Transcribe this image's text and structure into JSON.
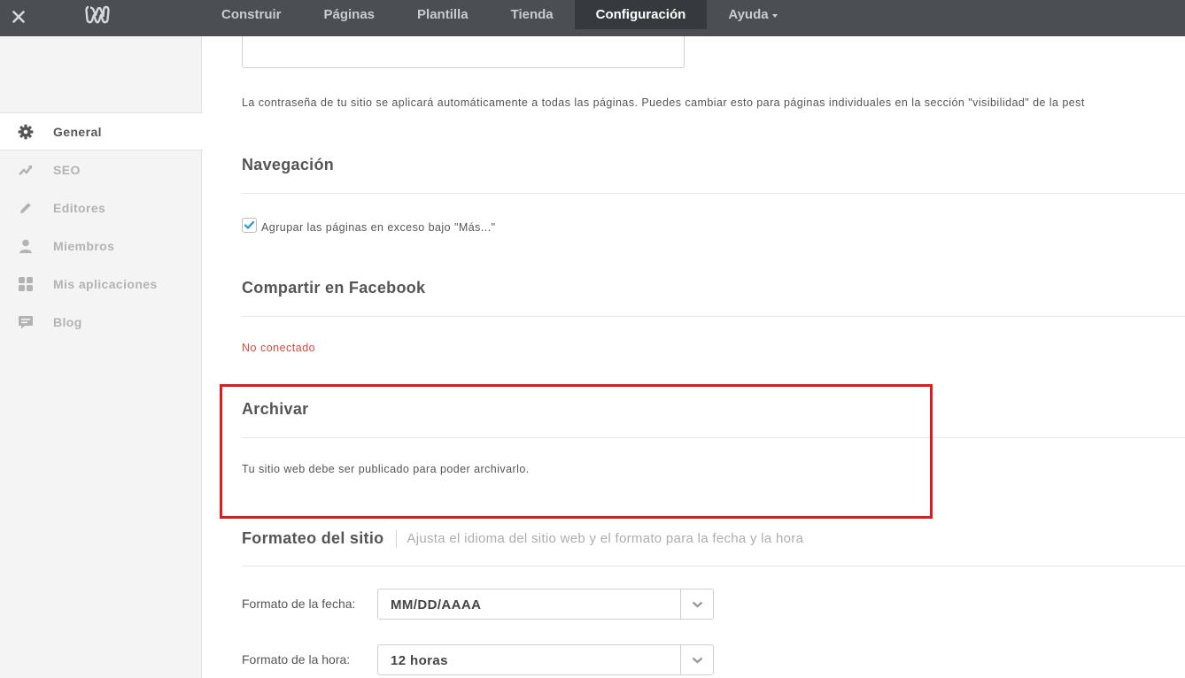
{
  "topbar": {
    "nav": [
      "Construir",
      "Páginas",
      "Plantilla",
      "Tienda",
      "Configuración",
      "Ayuda"
    ],
    "active": "Configuración"
  },
  "sidebar": {
    "items": [
      {
        "label": "General",
        "icon": "gear-icon"
      },
      {
        "label": "SEO",
        "icon": "trend-icon"
      },
      {
        "label": "Editores",
        "icon": "pencil-icon"
      },
      {
        "label": "Miembros",
        "icon": "person-icon"
      },
      {
        "label": "Mis aplicaciones",
        "icon": "apps-grid-icon"
      },
      {
        "label": "Blog",
        "icon": "comment-icon"
      }
    ],
    "active": "General"
  },
  "main": {
    "password_note": "La contraseña de tu sitio se aplicará automáticamente a todas las páginas. Puedes cambiar esto para páginas individuales en la sección \"visibilidad\" de la pest",
    "navigation": {
      "title": "Navegación",
      "checkbox_label": "Agrupar las páginas en exceso bajo \"Más...\"",
      "checked": true
    },
    "facebook": {
      "title": "Compartir en Facebook",
      "status": "No conectado"
    },
    "archive": {
      "title": "Archivar",
      "text": "Tu sitio web debe ser publicado para poder archivarlo."
    },
    "formatting": {
      "title": "Formateo del sitio",
      "subtitle": "Ajusta el idioma del sitio web y el formato para la fecha y la hora",
      "date_label": "Formato de la fecha:",
      "date_value": "MM/DD/AAAA",
      "time_label": "Formato de la hora:",
      "time_value": "12 horas"
    }
  },
  "colors": {
    "topbar": "#4b4f54",
    "active_tab": "#36393d",
    "sidebar_bg": "#f4f4f4",
    "status_red": "#e0473c",
    "highlight": "#e01b1b",
    "checkbox_tick": "#2d8fd5"
  }
}
